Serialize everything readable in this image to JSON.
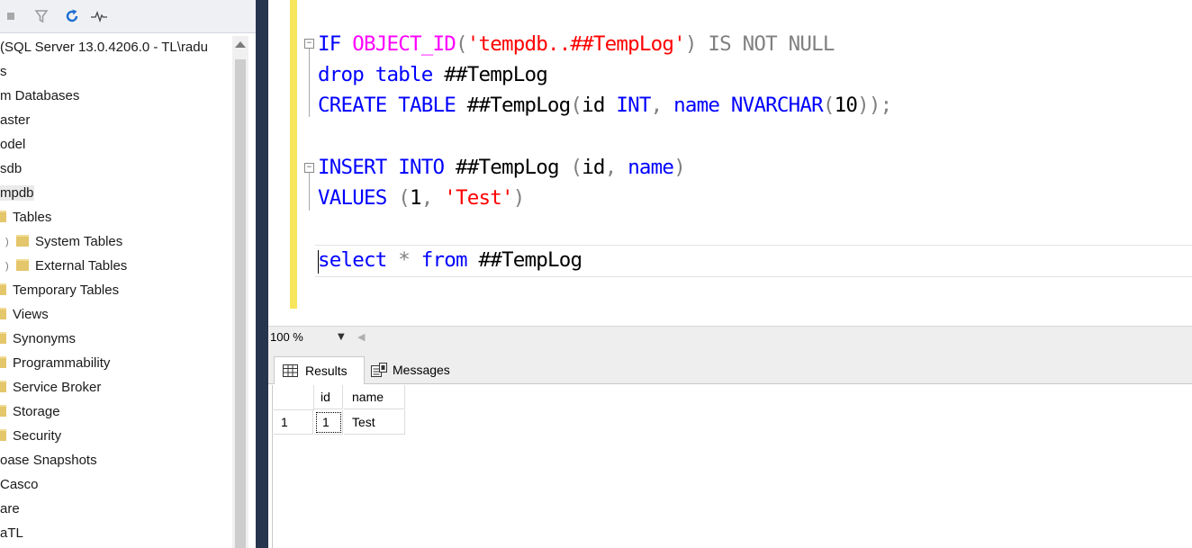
{
  "explorer": {
    "tree": [
      {
        "label": "(SQL Server 13.0.4206.0 - TL\\radu",
        "folder": false,
        "selected": false
      },
      {
        "label": "s",
        "folder": false,
        "selected": false
      },
      {
        "label": "m Databases",
        "folder": false,
        "selected": false
      },
      {
        "label": "aster",
        "folder": false,
        "selected": false
      },
      {
        "label": "odel",
        "folder": false,
        "selected": false
      },
      {
        "label": "sdb",
        "folder": false,
        "selected": false
      },
      {
        "label": "mpdb",
        "folder": false,
        "selected": true
      },
      {
        "label": "Tables",
        "folder": true,
        "selected": false
      },
      {
        "label": "System Tables",
        "folder": true,
        "selected": false
      },
      {
        "label": "External Tables",
        "folder": true,
        "selected": false
      },
      {
        "label": "Temporary Tables",
        "folder": true,
        "selected": false
      },
      {
        "label": "Views",
        "folder": true,
        "selected": false
      },
      {
        "label": "Synonyms",
        "folder": true,
        "selected": false
      },
      {
        "label": "Programmability",
        "folder": true,
        "selected": false
      },
      {
        "label": "Service Broker",
        "folder": true,
        "selected": false
      },
      {
        "label": "Storage",
        "folder": true,
        "selected": false
      },
      {
        "label": "Security",
        "folder": true,
        "selected": false
      },
      {
        "label": "oase Snapshots",
        "folder": false,
        "selected": false
      },
      {
        "label": "Casco",
        "folder": false,
        "selected": false
      },
      {
        "label": "are",
        "folder": false,
        "selected": false
      },
      {
        "label": "aTL",
        "folder": false,
        "selected": false
      }
    ]
  },
  "editor": {
    "lines": [
      [
        [
          "kw",
          "IF "
        ],
        [
          "fn",
          "OBJECT_ID"
        ],
        [
          "gr",
          "("
        ],
        [
          "str",
          "'tempdb..##TempLog'"
        ],
        [
          "gr",
          ") IS NOT NULL"
        ]
      ],
      [
        [
          "kw",
          "drop table "
        ],
        [
          "tx",
          "##TempLog"
        ]
      ],
      [
        [
          "kw",
          "CREATE TABLE "
        ],
        [
          "tx",
          "##TempLog"
        ],
        [
          "gr",
          "("
        ],
        [
          "tx",
          "id "
        ],
        [
          "kw",
          "INT"
        ],
        [
          "gr",
          ", "
        ],
        [
          "kw",
          "name NVARCHAR"
        ],
        [
          "gr",
          "("
        ],
        [
          "tx",
          "10"
        ],
        [
          "gr",
          "));"
        ]
      ],
      [],
      [
        [
          "kw",
          "INSERT INTO "
        ],
        [
          "tx",
          "##TempLog "
        ],
        [
          "gr",
          "("
        ],
        [
          "tx",
          "id"
        ],
        [
          "gr",
          ", "
        ],
        [
          "kw",
          "name"
        ],
        [
          "gr",
          ")"
        ]
      ],
      [
        [
          "kw",
          "VALUES "
        ],
        [
          "gr",
          "("
        ],
        [
          "tx",
          "1"
        ],
        [
          "gr",
          ", "
        ],
        [
          "str",
          "'Test'"
        ],
        [
          "gr",
          ")"
        ]
      ],
      [],
      [
        [
          "kw",
          "select "
        ],
        [
          "gr",
          "* "
        ],
        [
          "kw",
          "from "
        ],
        [
          "tx",
          "##TempLog"
        ]
      ]
    ]
  },
  "zoom": {
    "value": "100 %"
  },
  "results": {
    "tabs": {
      "results": "Results",
      "messages": "Messages"
    },
    "columns": [
      "id",
      "name"
    ],
    "rows": [
      {
        "rownum": "1",
        "id": "1",
        "name": "Test"
      }
    ]
  },
  "colors": {
    "keyword": "#0000ff",
    "function": "#ff00ff",
    "string": "#ff0000",
    "operator": "#808080",
    "splitter": "#27344e",
    "change_bar": "#f7e55b"
  }
}
